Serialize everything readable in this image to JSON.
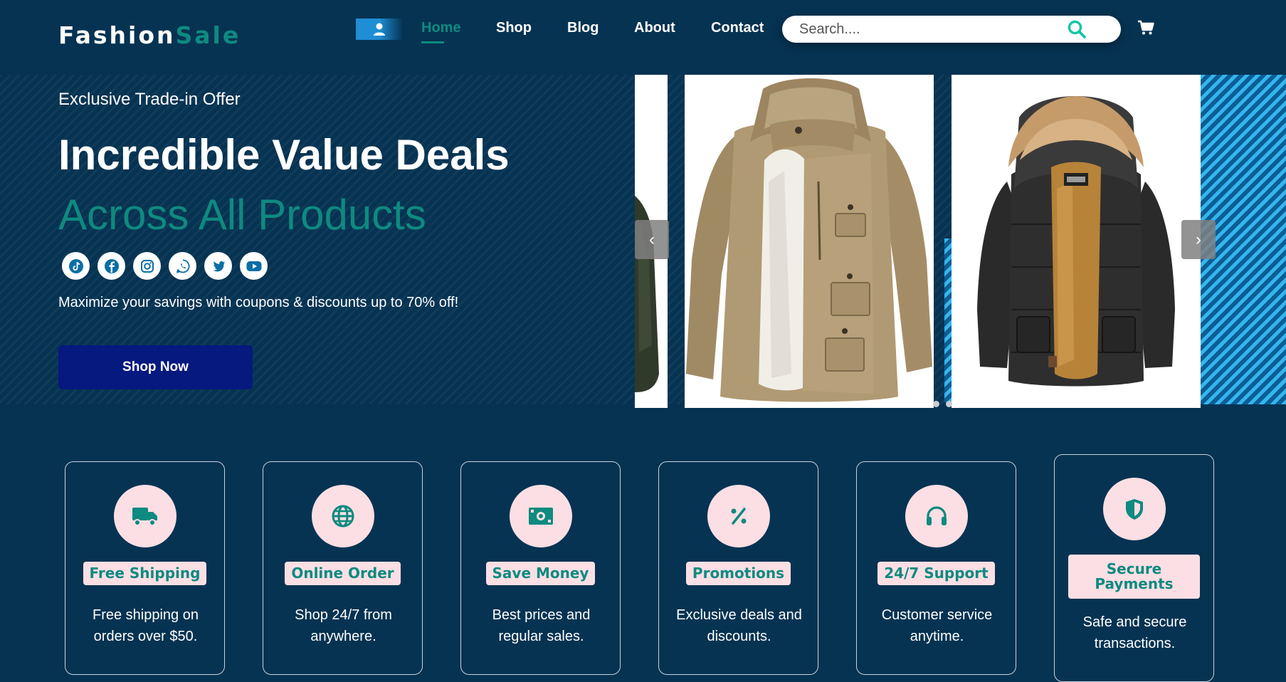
{
  "header": {
    "logo_main": "Fashion",
    "logo_accent": "Sale",
    "nav": [
      {
        "label": "Home",
        "active": true
      },
      {
        "label": "Shop",
        "active": false
      },
      {
        "label": "Blog",
        "active": false
      },
      {
        "label": "About",
        "active": false
      },
      {
        "label": "Contact",
        "active": false
      }
    ],
    "search": {
      "placeholder": "Search....",
      "value": ""
    },
    "icons": {
      "user": "user-icon",
      "search": "search-icon",
      "cart": "cart-icon"
    }
  },
  "hero": {
    "eyebrow": "Exclusive Trade-in Offer",
    "headline": "Incredible Value Deals",
    "subheadline": "Across All Products",
    "socials": [
      "tiktok-icon",
      "facebook-icon",
      "instagram-icon",
      "whatsapp-icon",
      "twitter-icon",
      "youtube-icon"
    ],
    "tagline": "Maximize your savings with coupons & discounts up to 70% off!",
    "cta": "Shop Now"
  },
  "carousel": {
    "prev_label": "‹",
    "next_label": "›",
    "slides": [
      "olive-jacket-image",
      "tan-parka-image",
      "black-parka-image"
    ],
    "dots": 2
  },
  "features": [
    {
      "icon": "truck-icon",
      "title": "Free Shipping",
      "desc": "Free shipping on orders over $50."
    },
    {
      "icon": "globe-icon",
      "title": "Online Order",
      "desc": "Shop 24/7 from anywhere."
    },
    {
      "icon": "money-icon",
      "title": "Save Money",
      "desc": "Best prices and regular sales."
    },
    {
      "icon": "percent-icon",
      "title": "Promotions",
      "desc": "Exclusive deals and discounts."
    },
    {
      "icon": "headset-icon",
      "title": "24/7 Support",
      "desc": "Customer service anytime."
    },
    {
      "icon": "shield-icon",
      "title": "Secure Payments",
      "desc": "Safe and secure transactions."
    }
  ],
  "colors": {
    "background": "#063352",
    "accent": "#0e8a80",
    "cta": "#06197f",
    "feature_badge": "#fbdfe4"
  }
}
